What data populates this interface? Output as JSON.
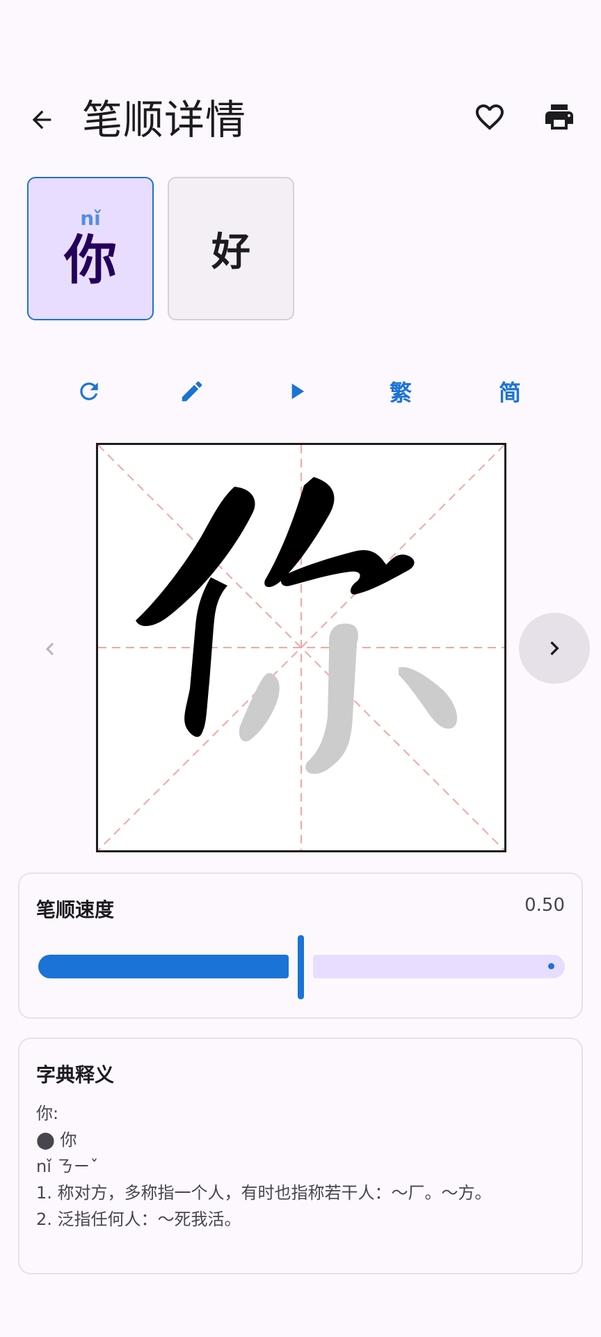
{
  "header": {
    "title": "笔顺详情",
    "back_icon": "arrow-back-icon",
    "favorite_icon": "heart-outline-icon",
    "print_icon": "print-icon"
  },
  "characters": [
    {
      "char": "你",
      "pinyin": "nǐ",
      "selected": true
    },
    {
      "char": "好",
      "pinyin": "",
      "selected": false
    }
  ],
  "toolbar": {
    "reset_icon": "refresh-icon",
    "edit_icon": "pencil-icon",
    "play_icon": "play-icon",
    "traditional_label": "繁",
    "simplified_label": "简"
  },
  "canvas": {
    "char": "你",
    "strokes_drawn": 4,
    "strokes_total": 7
  },
  "speed": {
    "label": "笔顺速度",
    "value_text": "0.50",
    "value": 0.5
  },
  "dictionary": {
    "title": "字典释义",
    "lines": [
      "你:",
      "⬤ 你",
      "nǐ ㄋㄧˇ",
      "1. 称对方，多称指一个人，有时也指称若干人：～厂。～方。",
      "2. 泛指任何人：～死我活。"
    ]
  },
  "colors": {
    "accent": "#1a73d6",
    "selected_card": "#e9ddff",
    "grid_line": "#f4a6a0",
    "stroke_drawn": "#000000",
    "stroke_pending": "#cccccc"
  }
}
